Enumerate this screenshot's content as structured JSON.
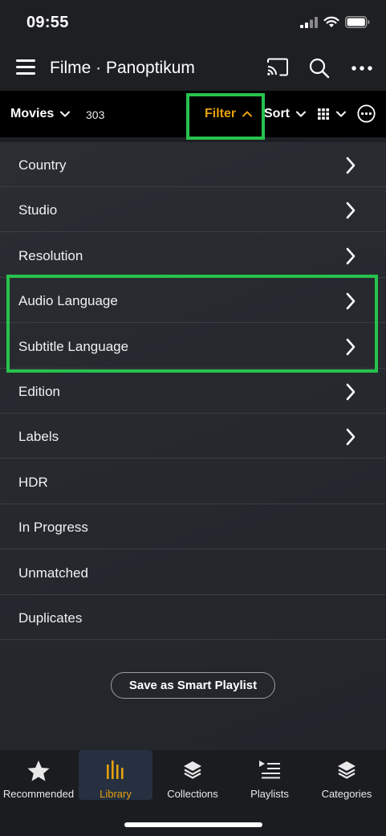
{
  "status_bar": {
    "time": "09:55"
  },
  "header": {
    "title": "Filme · Panoptikum"
  },
  "toolbar": {
    "library_label": "Movies",
    "count": "303",
    "filter_label": "Filter",
    "sort_label": "Sort"
  },
  "filters": {
    "items": [
      {
        "label": "Country"
      },
      {
        "label": "Studio"
      },
      {
        "label": "Resolution"
      },
      {
        "label": "Audio Language"
      },
      {
        "label": "Subtitle Language"
      },
      {
        "label": "Edition"
      },
      {
        "label": "Labels"
      },
      {
        "label": "HDR"
      },
      {
        "label": "In Progress"
      },
      {
        "label": "Unmatched"
      },
      {
        "label": "Duplicates"
      }
    ]
  },
  "save_smart_playlist_label": "Save as Smart Playlist",
  "bottom_nav": {
    "items": [
      {
        "label": "Recommended",
        "icon": "star-icon"
      },
      {
        "label": "Library",
        "icon": "library-icon"
      },
      {
        "label": "Collections",
        "icon": "stack-icon"
      },
      {
        "label": "Playlists",
        "icon": "playlist-icon"
      },
      {
        "label": "Categories",
        "icon": "stack-icon"
      }
    ],
    "active": "Library"
  },
  "colors": {
    "accent": "#e5a00d",
    "highlight": "#27c24c",
    "background": "#1c1f23"
  }
}
